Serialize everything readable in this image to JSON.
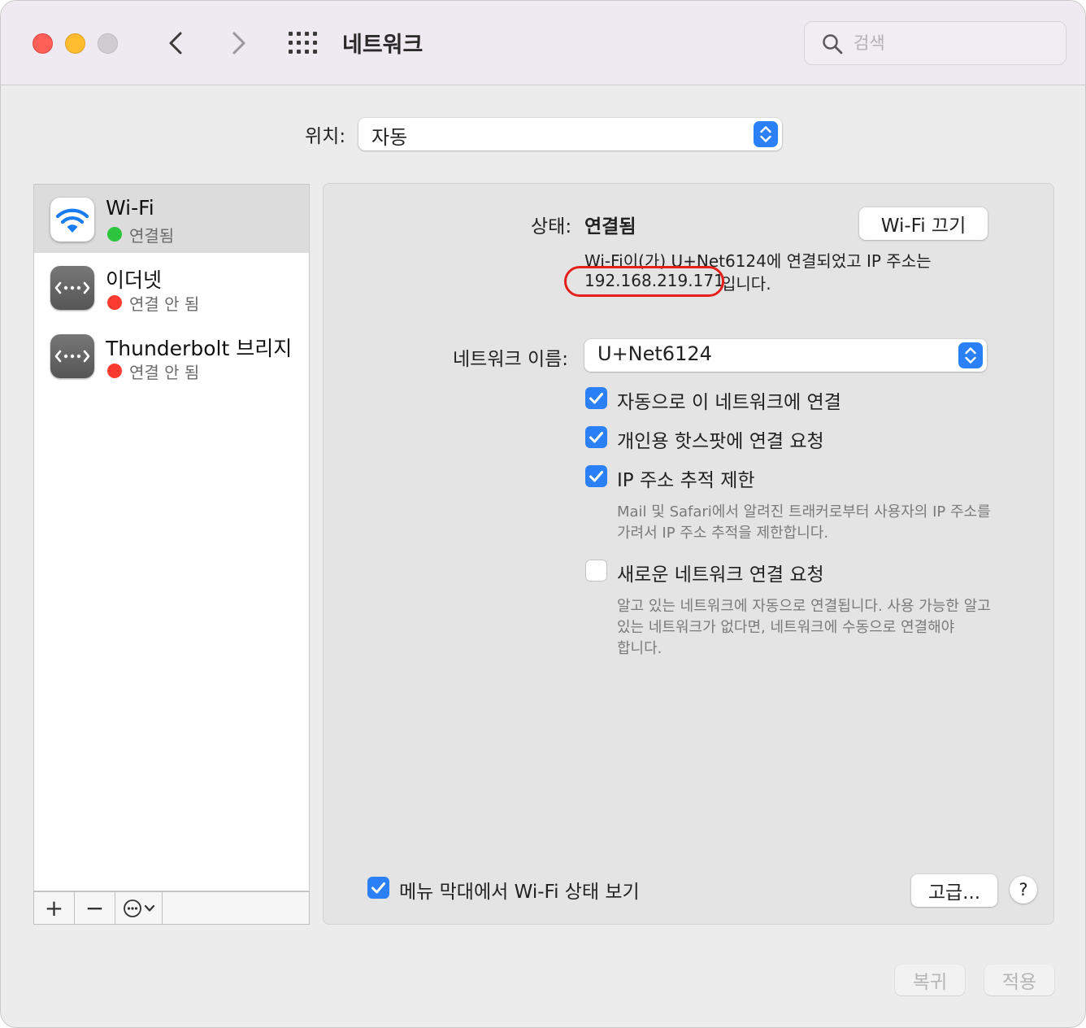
{
  "window": {
    "title": "네트워크"
  },
  "search": {
    "placeholder": "검색"
  },
  "location": {
    "label": "위치:",
    "value": "자동"
  },
  "services": [
    {
      "name": "Wi-Fi",
      "status": "연결됨",
      "status_color": "#2dc53e",
      "icon": "wifi-icon",
      "selected": true
    },
    {
      "name": "이더넷",
      "status": "연결 안 됨",
      "status_color": "#fb3b30",
      "icon": "ethernet-icon",
      "selected": false
    },
    {
      "name": "Thunderbolt 브리지",
      "status": "연결 안 됨",
      "status_color": "#fb3b30",
      "icon": "ethernet-icon",
      "selected": false
    }
  ],
  "sidebar_tools": {
    "add": "+",
    "remove": "−",
    "more": "⋯"
  },
  "detail": {
    "status_label": "상태:",
    "status_value": "연결됨",
    "wifi_off_button": "Wi-Fi 끄기",
    "status_desc_line1": "Wi-Fi이(가) U+Net6124에 연결되었고 IP 주소는",
    "ip_address": "192.168.219.171",
    "status_desc_suffix": "입니다.",
    "network_name_label": "네트워크 이름:",
    "network_name_value": "U+Net6124",
    "options": [
      {
        "label": "자동으로 이 네트워크에 연결",
        "checked": true
      },
      {
        "label": "개인용 핫스팟에 연결 요청",
        "checked": true
      },
      {
        "label": "IP 주소 추적 제한",
        "checked": true
      },
      {
        "label": "새로운 네트워크 연결 요청",
        "checked": false
      }
    ],
    "ip_tracking_note_line1": "Mail 및 Safari에서 알려진 트래커로부터 사용자의 IP 주소를",
    "ip_tracking_note_line2": "가려서 IP 주소 추적을 제한합니다.",
    "ask_join_note_line1": "알고 있는 네트워크에 자동으로 연결됩니다. 사용 가능한 알고",
    "ask_join_note_line2": "있는 네트워크가 없다면, 네트워크에 수동으로 연결해야",
    "ask_join_note_line3": "합니다.",
    "show_in_menubar": "메뉴 막대에서 Wi-Fi 상태 보기",
    "advanced_button": "고급...",
    "help_button": "?"
  },
  "footer": {
    "revert": "복귀",
    "apply": "적용"
  },
  "colors": {
    "accent": "#2b80f5",
    "highlight": "#e4201a"
  }
}
